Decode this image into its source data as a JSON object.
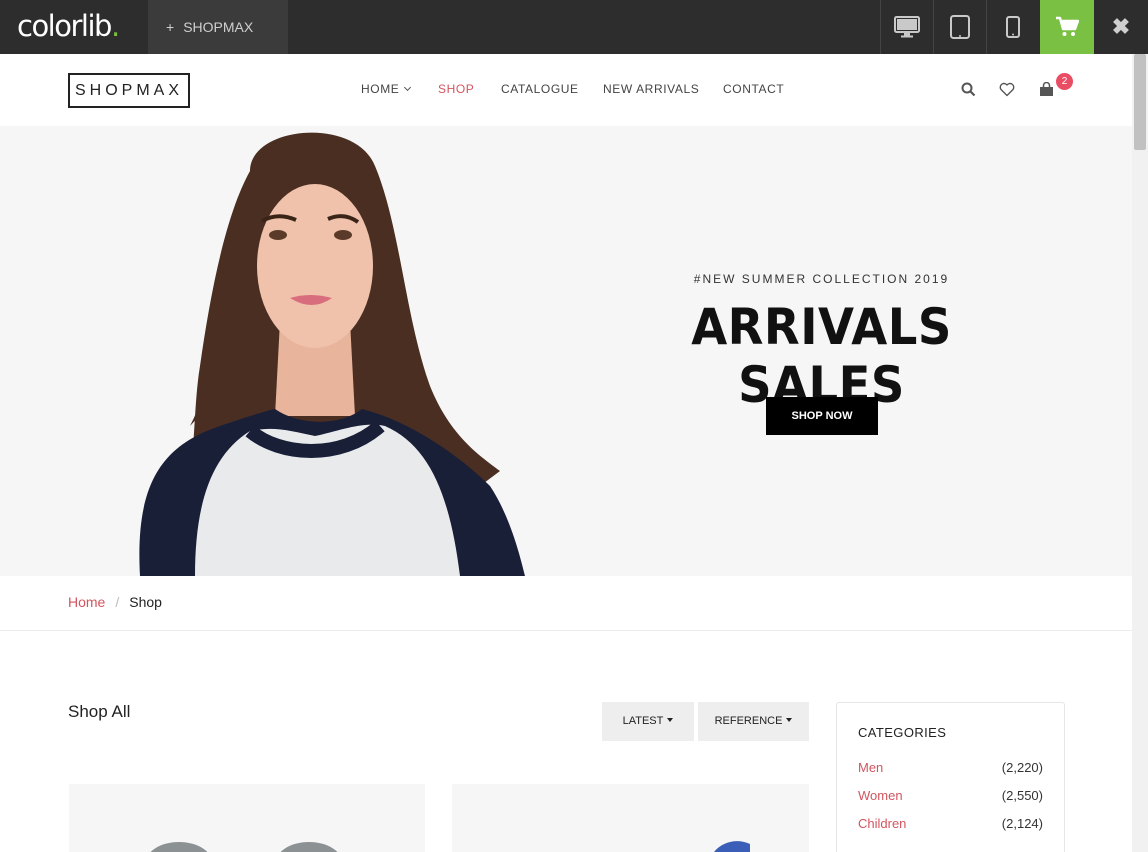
{
  "demo_bar": {
    "logo_text": "colorlib",
    "logo_dot": ".",
    "tab_plus": "+",
    "tab_label": "SHOPMAX",
    "devices": [
      "desktop-icon",
      "tablet-icon",
      "mobile-icon"
    ],
    "accent": "#7ac143"
  },
  "header": {
    "logo": "SHOPMAX",
    "nav": [
      {
        "label": "HOME",
        "dropdown": true,
        "active": false
      },
      {
        "label": "SHOP",
        "active": true
      },
      {
        "label": "CATALOGUE",
        "active": false
      },
      {
        "label": "NEW ARRIVALS",
        "active": false
      },
      {
        "label": "CONTACT",
        "active": false
      }
    ],
    "cart_count": "2",
    "accent": "#d2555f"
  },
  "hero": {
    "subtitle": "#NEW SUMMER COLLECTION 2019",
    "title": "ARRIVALS SALES",
    "button": "SHOP NOW"
  },
  "breadcrumb": {
    "home": "Home",
    "separator": "/",
    "current": "Shop"
  },
  "shop": {
    "title": "Shop All",
    "sort_latest": "LATEST",
    "sort_reference": "REFERENCE"
  },
  "categories": {
    "title": "CATEGORIES",
    "items": [
      {
        "name": "Men",
        "count": "(2,220)"
      },
      {
        "name": "Women",
        "count": "(2,550)"
      },
      {
        "name": "Children",
        "count": "(2,124)"
      }
    ]
  }
}
